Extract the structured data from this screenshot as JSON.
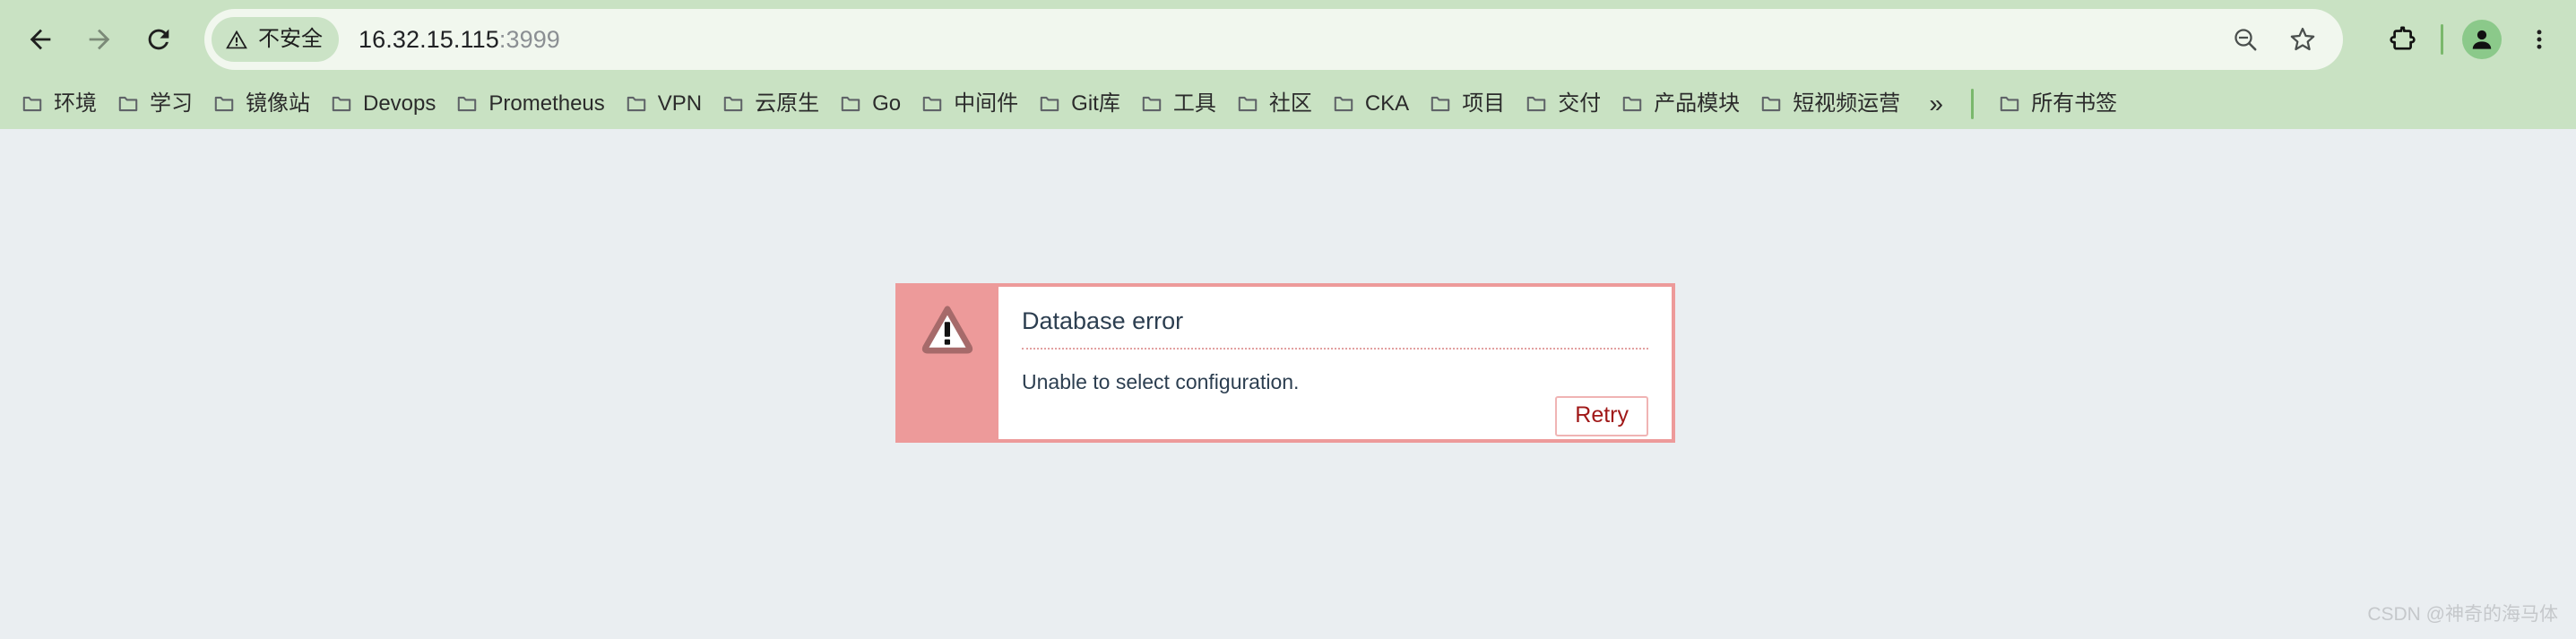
{
  "browser": {
    "nav": {
      "back_label": "Back",
      "forward_label": "Forward",
      "reload_label": "Reload"
    },
    "omnibox": {
      "security_label": "不安全",
      "url_host": "16.32.15.115",
      "url_port": ":3999",
      "zoom_out_label": "Zoom out",
      "bookmark_star_label": "Bookmark this tab"
    },
    "toolbar_right": {
      "extensions_label": "Extensions",
      "profile_label": "Profile",
      "menu_label": "Customize and control Google Chrome"
    },
    "colors": {
      "toolbar_bg": "#c9e2c3",
      "omnibox_bg": "#f1f7ee",
      "security_chip_bg": "#cbe3c6",
      "divider": "#7ab86c",
      "avatar_bg": "#8bc98a"
    }
  },
  "bookmarks": {
    "items": [
      {
        "label": "环境"
      },
      {
        "label": "学习"
      },
      {
        "label": "镜像站"
      },
      {
        "label": "Devops"
      },
      {
        "label": "Prometheus"
      },
      {
        "label": "VPN"
      },
      {
        "label": "云原生"
      },
      {
        "label": "Go"
      },
      {
        "label": "中间件"
      },
      {
        "label": "Git库"
      },
      {
        "label": "工具"
      },
      {
        "label": "社区"
      },
      {
        "label": "CKA"
      },
      {
        "label": "项目"
      },
      {
        "label": "交付"
      },
      {
        "label": "产品模块"
      },
      {
        "label": "短视频运营"
      }
    ],
    "overflow_label": "»",
    "all_bookmarks_label": "所有书签"
  },
  "page": {
    "background_color": "#eaeef1",
    "error_dialog": {
      "icon_name": "warning-triangle-icon",
      "title": "Database error",
      "message": "Unable to select configuration.",
      "retry_label": "Retry",
      "accent_color": "#ed9a9a",
      "title_color": "#2c3e50",
      "retry_text_color": "#a01818"
    },
    "watermark": "CSDN @神奇的海马体"
  }
}
